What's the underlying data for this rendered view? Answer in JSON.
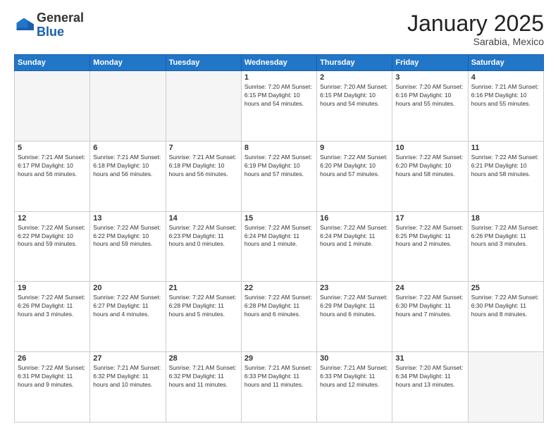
{
  "logo": {
    "general": "General",
    "blue": "Blue"
  },
  "header": {
    "month": "January 2025",
    "location": "Sarabia, Mexico"
  },
  "days_of_week": [
    "Sunday",
    "Monday",
    "Tuesday",
    "Wednesday",
    "Thursday",
    "Friday",
    "Saturday"
  ],
  "weeks": [
    [
      {
        "day": "",
        "info": ""
      },
      {
        "day": "",
        "info": ""
      },
      {
        "day": "",
        "info": ""
      },
      {
        "day": "1",
        "info": "Sunrise: 7:20 AM\nSunset: 6:15 PM\nDaylight: 10 hours\nand 54 minutes."
      },
      {
        "day": "2",
        "info": "Sunrise: 7:20 AM\nSunset: 6:15 PM\nDaylight: 10 hours\nand 54 minutes."
      },
      {
        "day": "3",
        "info": "Sunrise: 7:20 AM\nSunset: 6:16 PM\nDaylight: 10 hours\nand 55 minutes."
      },
      {
        "day": "4",
        "info": "Sunrise: 7:21 AM\nSunset: 6:16 PM\nDaylight: 10 hours\nand 55 minutes."
      }
    ],
    [
      {
        "day": "5",
        "info": "Sunrise: 7:21 AM\nSunset: 6:17 PM\nDaylight: 10 hours\nand 56 minutes."
      },
      {
        "day": "6",
        "info": "Sunrise: 7:21 AM\nSunset: 6:18 PM\nDaylight: 10 hours\nand 56 minutes."
      },
      {
        "day": "7",
        "info": "Sunrise: 7:21 AM\nSunset: 6:18 PM\nDaylight: 10 hours\nand 56 minutes."
      },
      {
        "day": "8",
        "info": "Sunrise: 7:22 AM\nSunset: 6:19 PM\nDaylight: 10 hours\nand 57 minutes."
      },
      {
        "day": "9",
        "info": "Sunrise: 7:22 AM\nSunset: 6:20 PM\nDaylight: 10 hours\nand 57 minutes."
      },
      {
        "day": "10",
        "info": "Sunrise: 7:22 AM\nSunset: 6:20 PM\nDaylight: 10 hours\nand 58 minutes."
      },
      {
        "day": "11",
        "info": "Sunrise: 7:22 AM\nSunset: 6:21 PM\nDaylight: 10 hours\nand 58 minutes."
      }
    ],
    [
      {
        "day": "12",
        "info": "Sunrise: 7:22 AM\nSunset: 6:22 PM\nDaylight: 10 hours\nand 59 minutes."
      },
      {
        "day": "13",
        "info": "Sunrise: 7:22 AM\nSunset: 6:22 PM\nDaylight: 10 hours\nand 59 minutes."
      },
      {
        "day": "14",
        "info": "Sunrise: 7:22 AM\nSunset: 6:23 PM\nDaylight: 11 hours\nand 0 minutes."
      },
      {
        "day": "15",
        "info": "Sunrise: 7:22 AM\nSunset: 6:24 PM\nDaylight: 11 hours\nand 1 minute."
      },
      {
        "day": "16",
        "info": "Sunrise: 7:22 AM\nSunset: 6:24 PM\nDaylight: 11 hours\nand 1 minute."
      },
      {
        "day": "17",
        "info": "Sunrise: 7:22 AM\nSunset: 6:25 PM\nDaylight: 11 hours\nand 2 minutes."
      },
      {
        "day": "18",
        "info": "Sunrise: 7:22 AM\nSunset: 6:26 PM\nDaylight: 11 hours\nand 3 minutes."
      }
    ],
    [
      {
        "day": "19",
        "info": "Sunrise: 7:22 AM\nSunset: 6:26 PM\nDaylight: 11 hours\nand 3 minutes."
      },
      {
        "day": "20",
        "info": "Sunrise: 7:22 AM\nSunset: 6:27 PM\nDaylight: 11 hours\nand 4 minutes."
      },
      {
        "day": "21",
        "info": "Sunrise: 7:22 AM\nSunset: 6:28 PM\nDaylight: 11 hours\nand 5 minutes."
      },
      {
        "day": "22",
        "info": "Sunrise: 7:22 AM\nSunset: 6:28 PM\nDaylight: 11 hours\nand 6 minutes."
      },
      {
        "day": "23",
        "info": "Sunrise: 7:22 AM\nSunset: 6:29 PM\nDaylight: 11 hours\nand 6 minutes."
      },
      {
        "day": "24",
        "info": "Sunrise: 7:22 AM\nSunset: 6:30 PM\nDaylight: 11 hours\nand 7 minutes."
      },
      {
        "day": "25",
        "info": "Sunrise: 7:22 AM\nSunset: 6:30 PM\nDaylight: 11 hours\nand 8 minutes."
      }
    ],
    [
      {
        "day": "26",
        "info": "Sunrise: 7:22 AM\nSunset: 6:31 PM\nDaylight: 11 hours\nand 9 minutes."
      },
      {
        "day": "27",
        "info": "Sunrise: 7:21 AM\nSunset: 6:32 PM\nDaylight: 11 hours\nand 10 minutes."
      },
      {
        "day": "28",
        "info": "Sunrise: 7:21 AM\nSunset: 6:32 PM\nDaylight: 11 hours\nand 11 minutes."
      },
      {
        "day": "29",
        "info": "Sunrise: 7:21 AM\nSunset: 6:33 PM\nDaylight: 11 hours\nand 11 minutes."
      },
      {
        "day": "30",
        "info": "Sunrise: 7:21 AM\nSunset: 6:33 PM\nDaylight: 11 hours\nand 12 minutes."
      },
      {
        "day": "31",
        "info": "Sunrise: 7:20 AM\nSunset: 6:34 PM\nDaylight: 11 hours\nand 13 minutes."
      },
      {
        "day": "",
        "info": ""
      }
    ]
  ]
}
